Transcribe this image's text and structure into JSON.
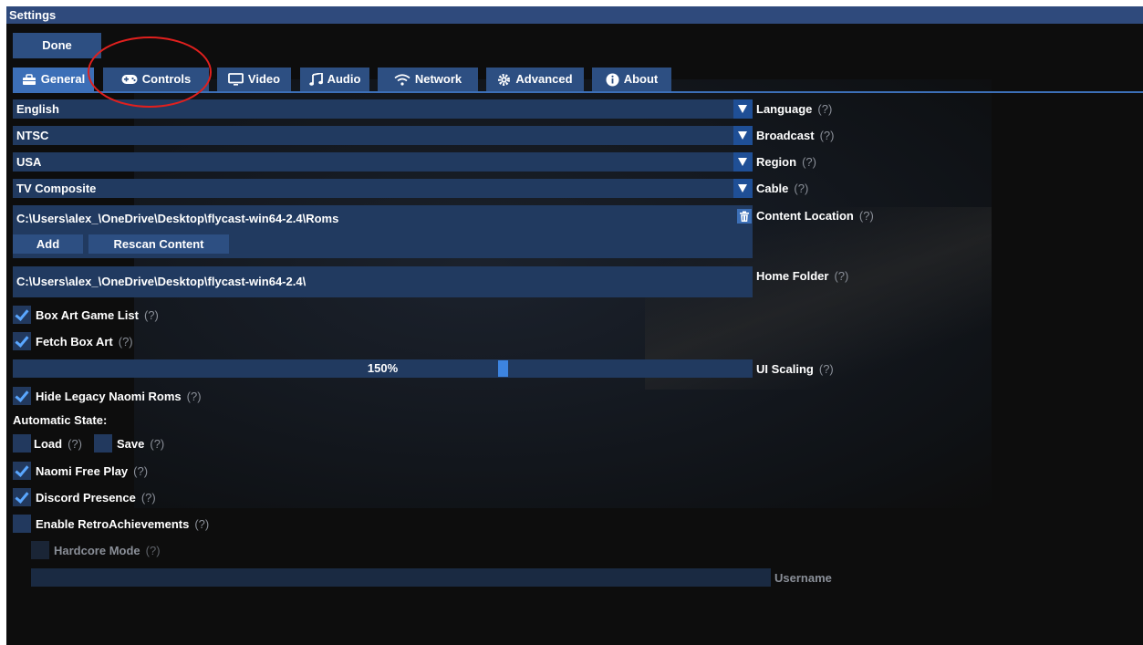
{
  "window": {
    "title": "Settings"
  },
  "toolbar": {
    "done_label": "Done"
  },
  "tabs": [
    {
      "label": "General",
      "icon": "toolbox-icon",
      "active": true
    },
    {
      "label": "Controls",
      "icon": "gamepad-icon",
      "active": false
    },
    {
      "label": "Video",
      "icon": "monitor-icon",
      "active": false
    },
    {
      "label": "Audio",
      "icon": "music-icon",
      "active": false
    },
    {
      "label": "Network",
      "icon": "wifi-icon",
      "active": false
    },
    {
      "label": "Advanced",
      "icon": "gear-icon",
      "active": false
    },
    {
      "label": "About",
      "icon": "info-icon",
      "active": false
    }
  ],
  "settings": {
    "help": "(?)",
    "language": {
      "value": "English",
      "label": "Language"
    },
    "broadcast": {
      "value": "NTSC",
      "label": "Broadcast"
    },
    "region": {
      "value": "USA",
      "label": "Region"
    },
    "cable": {
      "value": "TV Composite",
      "label": "Cable"
    },
    "content": {
      "path": "C:\\Users\\alex_\\OneDrive\\Desktop\\flycast-win64-2.4\\Roms",
      "label": "Content Location",
      "add_label": "Add",
      "rescan_label": "Rescan Content"
    },
    "home": {
      "path": "C:\\Users\\alex_\\OneDrive\\Desktop\\flycast-win64-2.4\\",
      "label": "Home Folder"
    },
    "box_art_list": {
      "label": "Box Art Game List",
      "checked": true
    },
    "fetch_box_art": {
      "label": "Fetch Box Art",
      "checked": true
    },
    "ui_scaling": {
      "value": "150%",
      "label": "UI Scaling"
    },
    "hide_legacy": {
      "label": "Hide Legacy Naomi Roms",
      "checked": true
    },
    "auto_state": {
      "heading": "Automatic State:",
      "load_label": "Load",
      "load_checked": false,
      "save_label": "Save",
      "save_checked": false
    },
    "naomi_free_play": {
      "label": "Naomi Free Play",
      "checked": true
    },
    "discord": {
      "label": "Discord Presence",
      "checked": true
    },
    "retro": {
      "label": "Enable RetroAchievements",
      "checked": false
    },
    "hardcore": {
      "label": "Hardcore Mode",
      "checked": false
    },
    "username": {
      "label": "Username",
      "value": ""
    }
  },
  "colors": {
    "accent": "#3c6fb7",
    "button": "#2d4f82",
    "field": "#213a60",
    "annotation": "#e0201e"
  }
}
